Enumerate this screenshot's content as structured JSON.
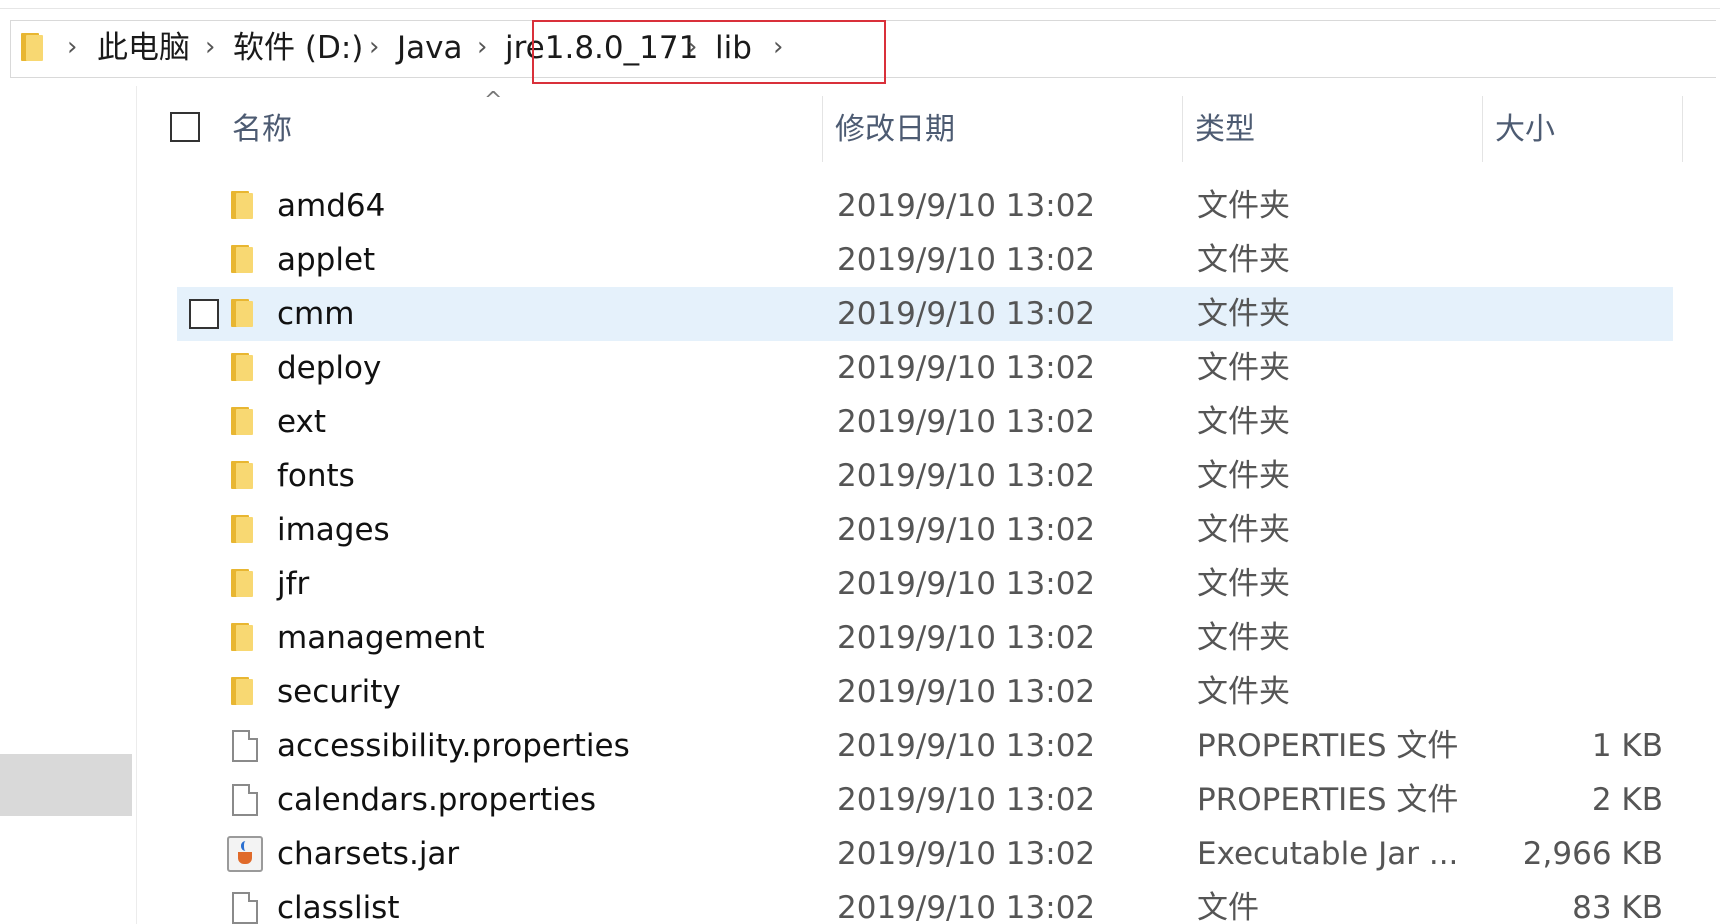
{
  "breadcrumb": {
    "items": [
      {
        "label": "此电脑"
      },
      {
        "label": "软件 (D:)"
      },
      {
        "label": "Java"
      },
      {
        "label": "jre1.8.0_171"
      },
      {
        "label": "lib"
      }
    ],
    "separator": "›"
  },
  "columns": {
    "name": "名称",
    "date": "修改日期",
    "type": "类型",
    "size": "大小"
  },
  "sort_indicator": "^",
  "files": [
    {
      "name": "amd64",
      "date": "2019/9/10 13:02",
      "type": "文件夹",
      "size": "",
      "icon": "folder-icon"
    },
    {
      "name": "applet",
      "date": "2019/9/10 13:02",
      "type": "文件夹",
      "size": "",
      "icon": "folder-icon"
    },
    {
      "name": "cmm",
      "date": "2019/9/10 13:02",
      "type": "文件夹",
      "size": "",
      "icon": "folder-icon",
      "hovered": true
    },
    {
      "name": "deploy",
      "date": "2019/9/10 13:02",
      "type": "文件夹",
      "size": "",
      "icon": "folder-icon"
    },
    {
      "name": "ext",
      "date": "2019/9/10 13:02",
      "type": "文件夹",
      "size": "",
      "icon": "folder-icon"
    },
    {
      "name": "fonts",
      "date": "2019/9/10 13:02",
      "type": "文件夹",
      "size": "",
      "icon": "folder-icon"
    },
    {
      "name": "images",
      "date": "2019/9/10 13:02",
      "type": "文件夹",
      "size": "",
      "icon": "folder-icon"
    },
    {
      "name": "jfr",
      "date": "2019/9/10 13:02",
      "type": "文件夹",
      "size": "",
      "icon": "folder-icon"
    },
    {
      "name": "management",
      "date": "2019/9/10 13:02",
      "type": "文件夹",
      "size": "",
      "icon": "folder-icon"
    },
    {
      "name": "security",
      "date": "2019/9/10 13:02",
      "type": "文件夹",
      "size": "",
      "icon": "folder-icon"
    },
    {
      "name": "accessibility.properties",
      "date": "2019/9/10 13:02",
      "type": "PROPERTIES 文件",
      "size": "1 KB",
      "icon": "file-icon"
    },
    {
      "name": "calendars.properties",
      "date": "2019/9/10 13:02",
      "type": "PROPERTIES 文件",
      "size": "2 KB",
      "icon": "file-icon"
    },
    {
      "name": "charsets.jar",
      "date": "2019/9/10 13:02",
      "type": "Executable Jar ...",
      "size": "2,966 KB",
      "icon": "java-jar-icon"
    },
    {
      "name": "classlist",
      "date": "2019/9/10 13:02",
      "type": "文件",
      "size": "83 KB",
      "icon": "file-icon"
    }
  ],
  "colors": {
    "highlight_border": "#d9303a",
    "hover_row": "#e5f1fb",
    "header_text": "#4d5b72",
    "folder": "#f8d872"
  }
}
